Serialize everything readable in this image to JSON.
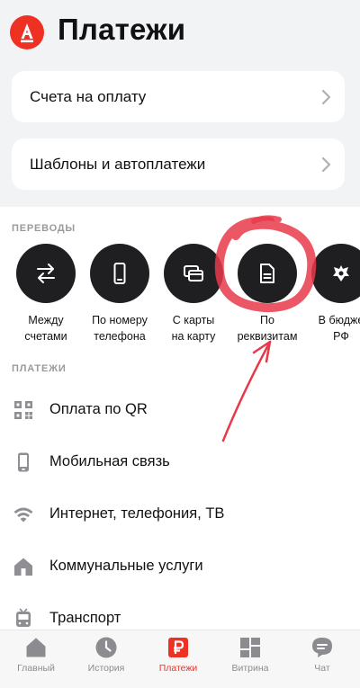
{
  "header": {
    "title": "Платежи"
  },
  "cards": [
    {
      "label": "Счета на оплату"
    },
    {
      "label": "Шаблоны и автоплатежи"
    }
  ],
  "transfers": {
    "section_label": "ПЕРЕВОДЫ",
    "items": [
      {
        "label": "Между\nсчетами",
        "icon": "swap-arrows-icon"
      },
      {
        "label": "По номеру\nтелефона",
        "icon": "phone-icon"
      },
      {
        "label": "С карты\nна карту",
        "icon": "cards-icon"
      },
      {
        "label": "По\nреквизитам",
        "icon": "document-icon"
      },
      {
        "label": "В бюдже\nРФ",
        "icon": "emblem-icon"
      }
    ]
  },
  "payments": {
    "section_label": "ПЛАТЕЖИ",
    "items": [
      {
        "label": "Оплата по QR",
        "icon": "qr-icon"
      },
      {
        "label": "Мобильная связь",
        "icon": "mobile-icon"
      },
      {
        "label": "Интернет, телефония, ТВ",
        "icon": "wifi-icon"
      },
      {
        "label": "Коммунальные услуги",
        "icon": "house-icon"
      },
      {
        "label": "Транспорт",
        "icon": "bus-icon"
      }
    ]
  },
  "tabbar": {
    "items": [
      {
        "label": "Главный",
        "icon": "home-icon"
      },
      {
        "label": "История",
        "icon": "clock-icon"
      },
      {
        "label": "Платежи",
        "icon": "ruble-icon",
        "active": true
      },
      {
        "label": "Витрина",
        "icon": "grid-icon"
      },
      {
        "label": "Чат",
        "icon": "chat-icon"
      }
    ]
  },
  "colors": {
    "accent": "#ef3124",
    "circle": "#1f1f21",
    "background": "#f2f3f5",
    "annotation": "#e8394a"
  }
}
